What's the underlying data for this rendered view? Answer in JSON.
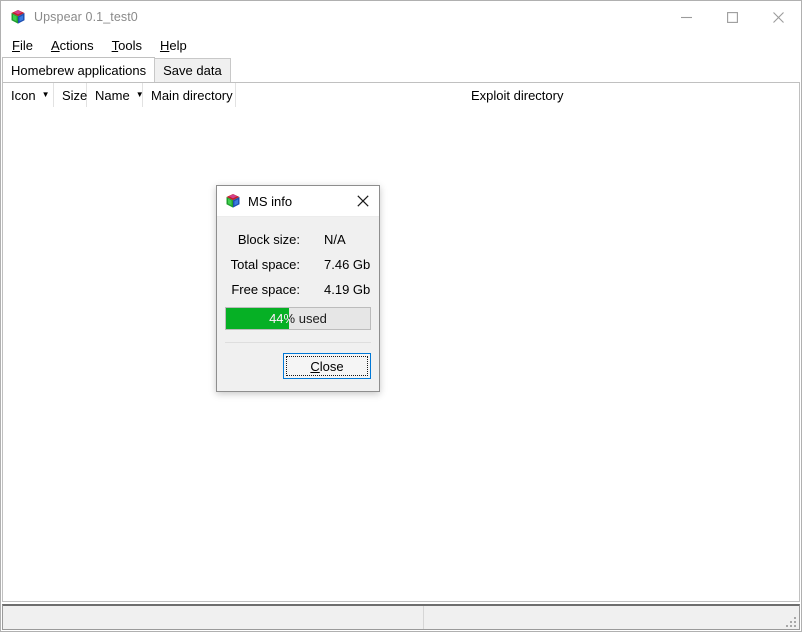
{
  "window": {
    "title": "Upspear 0.1_test0",
    "icon": "app-cube-icon",
    "controls": {
      "minimize": "minimize-icon",
      "maximize": "maximize-icon",
      "close": "close-icon"
    }
  },
  "menubar": {
    "items": [
      {
        "label": "File",
        "accel": "F"
      },
      {
        "label": "Actions",
        "accel": "A"
      },
      {
        "label": "Tools",
        "accel": "T"
      },
      {
        "label": "Help",
        "accel": "H"
      }
    ]
  },
  "tabs": [
    {
      "label": "Homebrew applications",
      "active": true
    },
    {
      "label": "Save data",
      "active": false
    }
  ],
  "columns": [
    {
      "label": "Icon",
      "sortable": true,
      "arrow": "▼"
    },
    {
      "label": "Size",
      "sortable": false,
      "arrow": ""
    },
    {
      "label": "Name",
      "sortable": true,
      "arrow": "▼"
    },
    {
      "label": "Main directory",
      "sortable": false,
      "arrow": ""
    },
    {
      "label": "Exploit directory",
      "sortable": false,
      "arrow": ""
    }
  ],
  "list": {
    "rows": []
  },
  "statusbar": {
    "text": "",
    "grip": "resize-grip-icon"
  },
  "dialog": {
    "title": "MS info",
    "icon": "app-cube-icon",
    "close_icon": "close-icon",
    "info": [
      {
        "label": "Block size:",
        "value": "N/A"
      },
      {
        "label": "Total space:",
        "value": "7.46 Gb"
      },
      {
        "label": "Free space:",
        "value": "4.19 Gb"
      }
    ],
    "progress": {
      "percent": 44,
      "text": "44% used",
      "fill_color": "#06b025",
      "track_color": "#e6e6e6"
    },
    "button": {
      "label": "Close",
      "accel": "C",
      "focused": true
    }
  },
  "colors": {
    "accent": "#0078d7",
    "progress_green": "#06b025",
    "title_text": "#8a8a8a",
    "dialog_bg": "#f0f0f0"
  }
}
